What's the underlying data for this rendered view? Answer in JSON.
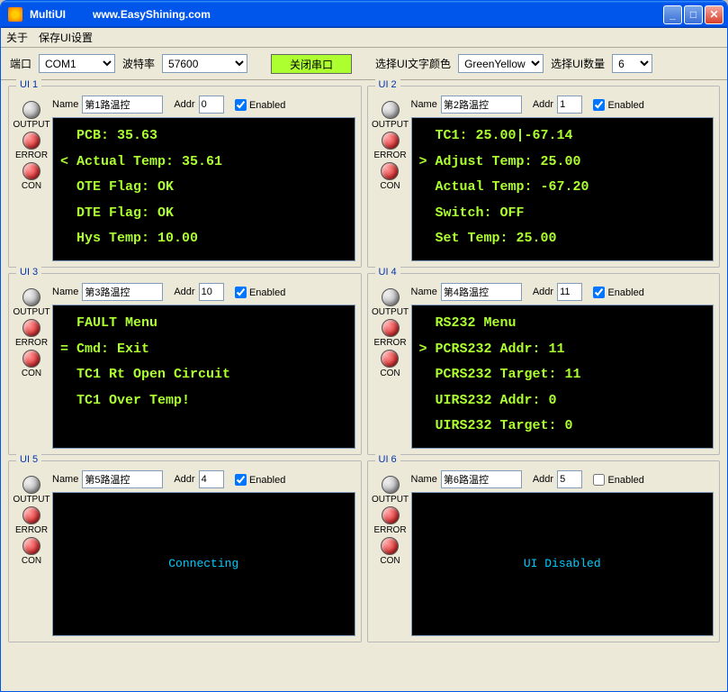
{
  "window": {
    "title": "MultiUI",
    "url": "www.EasyShining.com"
  },
  "menu": {
    "about": "关于",
    "save": "保存UI设置"
  },
  "toolbar": {
    "port_label": "端口",
    "port_value": "COM1",
    "baud_label": "波特率",
    "baud_value": "57600",
    "close_button": "关闭串口",
    "color_label": "选择UI文字颜色",
    "color_value": "GreenYellow",
    "count_label": "选择UI数量",
    "count_value": "6"
  },
  "labels": {
    "name": "Name",
    "addr": "Addr",
    "enabled": "Enabled",
    "output": "OUTPUT",
    "error": "ERROR",
    "con": "CON"
  },
  "panels": [
    {
      "title": "UI 1",
      "name": "第1路温控",
      "addr": "0",
      "enabled": true,
      "lines": [
        "  PCB: 35.63",
        "< Actual Temp: 35.61",
        "  OTE Flag: OK",
        "  DTE Flag: OK",
        "  Hys Temp: 10.00"
      ],
      "center": null,
      "led_output": "gray",
      "led_error": "red",
      "led_con": "red"
    },
    {
      "title": "UI 2",
      "name": "第2路温控",
      "addr": "1",
      "enabled": true,
      "lines": [
        "  TC1: 25.00|-67.14",
        "> Adjust Temp: 25.00",
        "  Actual Temp: -67.20",
        "  Switch: OFF",
        "  Set Temp: 25.00"
      ],
      "center": null,
      "led_output": "gray",
      "led_error": "red",
      "led_con": "red"
    },
    {
      "title": "UI 3",
      "name": "第3路温控",
      "addr": "10",
      "enabled": true,
      "lines": [
        "  FAULT Menu",
        "= Cmd: Exit",
        "  TC1 Rt Open Circuit",
        "  TC1 Over Temp!"
      ],
      "center": null,
      "led_output": "gray",
      "led_error": "red",
      "led_con": "red"
    },
    {
      "title": "UI 4",
      "name": "第4路温控",
      "addr": "11",
      "enabled": true,
      "lines": [
        "  RS232 Menu",
        "> PCRS232 Addr: 11",
        "  PCRS232 Target: 11",
        "  UIRS232 Addr: 0",
        "  UIRS232 Target: 0"
      ],
      "center": null,
      "led_output": "gray",
      "led_error": "red",
      "led_con": "red"
    },
    {
      "title": "UI 5",
      "name": "第5路温控",
      "addr": "4",
      "enabled": true,
      "lines": null,
      "center": "Connecting",
      "led_output": "gray",
      "led_error": "red",
      "led_con": "red"
    },
    {
      "title": "UI 6",
      "name": "第6路温控",
      "addr": "5",
      "enabled": false,
      "lines": null,
      "center": "UI Disabled",
      "led_output": "gray",
      "led_error": "red",
      "led_con": "red"
    }
  ]
}
